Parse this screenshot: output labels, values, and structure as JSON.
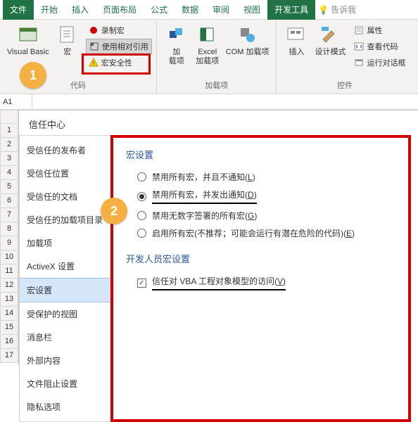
{
  "tabs": {
    "file": "文件",
    "home": "开始",
    "insert": "插入",
    "page_layout": "页面布局",
    "formulas": "公式",
    "data": "数据",
    "review": "审阅",
    "view": "视图",
    "developer": "开发工具",
    "tell_me": "告诉我"
  },
  "ribbon": {
    "code": {
      "visual_basic": "Visual Basic",
      "macros": "宏",
      "record_macro": "录制宏",
      "use_relative": "使用相对引用",
      "macro_security": "宏安全性",
      "group_label": "代码"
    },
    "addins": {
      "addins": "加\n载项",
      "excel_addins": "Excel\n加载项",
      "com_addins": "COM 加载项",
      "group_label": "加载项"
    },
    "controls": {
      "insert": "插入",
      "design_mode": "设计模式",
      "properties": "属性",
      "view_code": "查看代码",
      "run_dialog": "运行对话框",
      "group_label": "控件"
    }
  },
  "badges": {
    "one": "1",
    "two": "2"
  },
  "name_box": "A1",
  "row_headers": [
    "1",
    "2",
    "3",
    "4",
    "5",
    "6",
    "7",
    "8",
    "9",
    "10",
    "11",
    "12",
    "13",
    "14",
    "15",
    "16",
    "17"
  ],
  "dialog": {
    "title": "信任中心",
    "sidebar": [
      "受信任的发布者",
      "受信任位置",
      "受信任的文档",
      "受信任的加载项目录",
      "加载项",
      "ActiveX 设置",
      "宏设置",
      "受保护的视图",
      "消息栏",
      "外部内容",
      "文件阻止设置",
      "隐私选项"
    ],
    "sidebar_selected_index": 6,
    "macro_section_title": "宏设置",
    "macro_options": [
      {
        "label": "禁用所有宏，并且不通知",
        "hotkey": "L"
      },
      {
        "label": "禁用所有宏，并发出通知",
        "hotkey": "D"
      },
      {
        "label": "禁用无数字签署的所有宏",
        "hotkey": "G"
      },
      {
        "label": "启用所有宏(不推荐；可能会运行有潜在危险的代码)",
        "hotkey": "E"
      }
    ],
    "macro_selected_index": 1,
    "dev_section_title": "开发人员宏设置",
    "dev_check_label": "信任对 VBA 工程对象模型的访问",
    "dev_check_hotkey": "V",
    "dev_check_checked": true
  }
}
